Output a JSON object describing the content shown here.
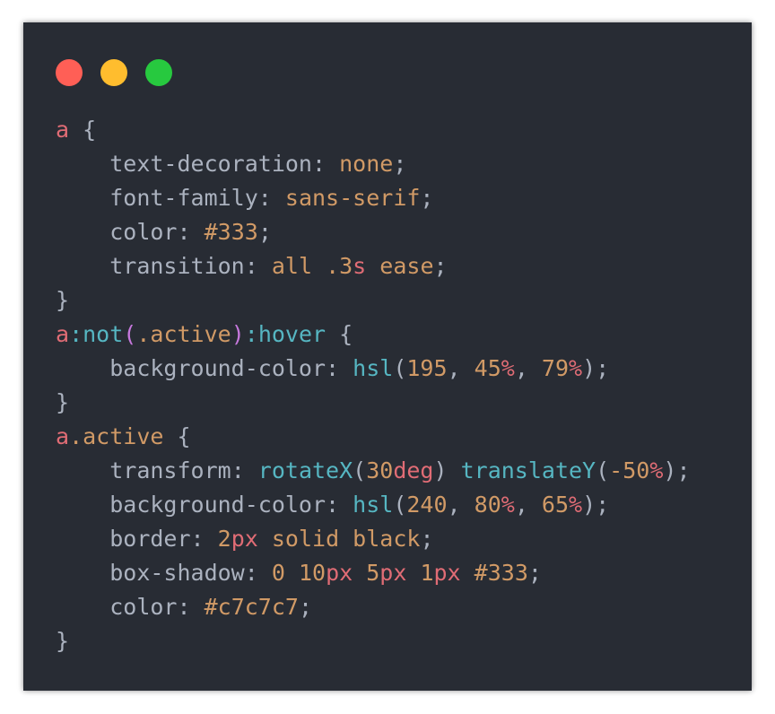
{
  "window_dots": [
    "close",
    "minimize",
    "maximize"
  ],
  "colors": {
    "background": "#282c34",
    "close_dot": "#ff5f56",
    "minimize_dot": "#ffbd2e",
    "maximize_dot": "#27c93f",
    "selector": "#e06c75",
    "pseudo": "#56b6c2",
    "paren": "#c678dd",
    "property": "#abb2bf",
    "value": "#d19a66",
    "unit": "#e06c75",
    "function": "#56b6c2"
  },
  "code_lines": [
    [
      [
        "sel",
        "a"
      ],
      [
        "punc",
        " {"
      ]
    ],
    [
      [
        "punc",
        "    "
      ],
      [
        "prop",
        "text-decoration"
      ],
      [
        "punc",
        ": "
      ],
      [
        "val",
        "none"
      ],
      [
        "punc",
        ";"
      ]
    ],
    [
      [
        "punc",
        "    "
      ],
      [
        "prop",
        "font-family"
      ],
      [
        "punc",
        ": "
      ],
      [
        "val",
        "sans-serif"
      ],
      [
        "punc",
        ";"
      ]
    ],
    [
      [
        "punc",
        "    "
      ],
      [
        "prop",
        "color"
      ],
      [
        "punc",
        ": "
      ],
      [
        "val",
        "#333"
      ],
      [
        "punc",
        ";"
      ]
    ],
    [
      [
        "punc",
        "    "
      ],
      [
        "prop",
        "transition"
      ],
      [
        "punc",
        ": "
      ],
      [
        "val",
        "all "
      ],
      [
        "num",
        ".3"
      ],
      [
        "unit",
        "s"
      ],
      [
        "val",
        " ease"
      ],
      [
        "punc",
        ";"
      ]
    ],
    [
      [
        "punc",
        "}"
      ]
    ],
    [
      [
        "sel",
        "a"
      ],
      [
        "pseudo",
        ":not"
      ],
      [
        "paren",
        "("
      ],
      [
        "cls",
        ".active"
      ],
      [
        "paren",
        ")"
      ],
      [
        "pseudo",
        ":hover"
      ],
      [
        "punc",
        " {"
      ]
    ],
    [
      [
        "punc",
        "    "
      ],
      [
        "prop",
        "background-color"
      ],
      [
        "punc",
        ": "
      ],
      [
        "fn",
        "hsl"
      ],
      [
        "punc",
        "("
      ],
      [
        "num",
        "195"
      ],
      [
        "punc",
        ", "
      ],
      [
        "num",
        "45"
      ],
      [
        "unit",
        "%"
      ],
      [
        "punc",
        ", "
      ],
      [
        "num",
        "79"
      ],
      [
        "unit",
        "%"
      ],
      [
        "punc",
        ");"
      ]
    ],
    [
      [
        "punc",
        "}"
      ]
    ],
    [
      [
        "sel",
        "a"
      ],
      [
        "cls",
        ".active"
      ],
      [
        "punc",
        " {"
      ]
    ],
    [
      [
        "punc",
        "    "
      ],
      [
        "prop",
        "transform"
      ],
      [
        "punc",
        ": "
      ],
      [
        "fn",
        "rotateX"
      ],
      [
        "punc",
        "("
      ],
      [
        "num",
        "30"
      ],
      [
        "unit",
        "deg"
      ],
      [
        "punc",
        ") "
      ],
      [
        "fn",
        "translateY"
      ],
      [
        "punc",
        "("
      ],
      [
        "num",
        "-50"
      ],
      [
        "unit",
        "%"
      ],
      [
        "punc",
        ");"
      ]
    ],
    [
      [
        "punc",
        "    "
      ],
      [
        "prop",
        "background-color"
      ],
      [
        "punc",
        ": "
      ],
      [
        "fn",
        "hsl"
      ],
      [
        "punc",
        "("
      ],
      [
        "num",
        "240"
      ],
      [
        "punc",
        ", "
      ],
      [
        "num",
        "80"
      ],
      [
        "unit",
        "%"
      ],
      [
        "punc",
        ", "
      ],
      [
        "num",
        "65"
      ],
      [
        "unit",
        "%"
      ],
      [
        "punc",
        ");"
      ]
    ],
    [
      [
        "punc",
        "    "
      ],
      [
        "prop",
        "border"
      ],
      [
        "punc",
        ": "
      ],
      [
        "num",
        "2"
      ],
      [
        "unit",
        "px"
      ],
      [
        "val",
        " solid black"
      ],
      [
        "punc",
        ";"
      ]
    ],
    [
      [
        "punc",
        "    "
      ],
      [
        "prop",
        "box-shadow"
      ],
      [
        "punc",
        ": "
      ],
      [
        "num",
        "0 10"
      ],
      [
        "unit",
        "px"
      ],
      [
        "num",
        " 5"
      ],
      [
        "unit",
        "px"
      ],
      [
        "num",
        " 1"
      ],
      [
        "unit",
        "px"
      ],
      [
        "val",
        " #333"
      ],
      [
        "punc",
        ";"
      ]
    ],
    [
      [
        "punc",
        "    "
      ],
      [
        "prop",
        "color"
      ],
      [
        "punc",
        ": "
      ],
      [
        "val",
        "#c7c7c7"
      ],
      [
        "punc",
        ";"
      ]
    ],
    [
      [
        "punc",
        "}"
      ]
    ]
  ]
}
